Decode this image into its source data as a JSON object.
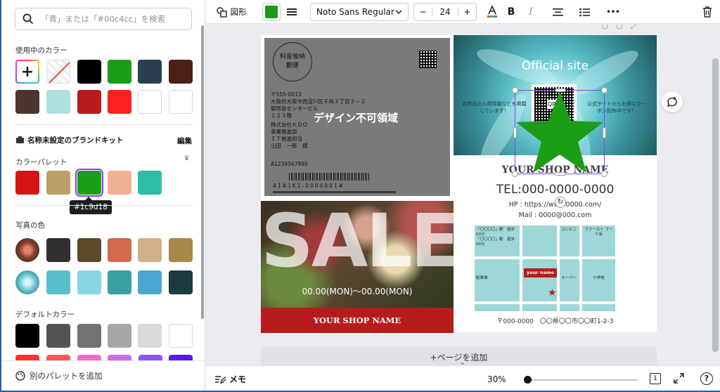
{
  "left_panel": {
    "search_placeholder": "「青」または「#00c4cc」を検索",
    "in_use_title": "使用中のカラー",
    "in_use_colors": [
      "#000000",
      "#1c9d18",
      "#2c3e50",
      "#4a2018",
      "#4a3530",
      "#aee0de",
      "#b81c1c",
      "#ff1f1f",
      "#ffffff",
      "#ffffff"
    ],
    "brand_kit": "名称未設定のブランドキット",
    "edit": "編集",
    "palette_title": "カラーパレット",
    "palette": [
      "#d71414",
      "#b9a064",
      "#1c9d18",
      "#f0b296",
      "#2ebca2"
    ],
    "tooltip": "#1c9d18",
    "photo_title": "写真の色",
    "photo_colors_1": [
      "#2f2f2f",
      "#5d4a2b",
      "#d36a4c",
      "#cfb08c",
      "#a88848"
    ],
    "photo_colors_2": [
      "#56bfcb",
      "#88d6e4",
      "#3aa19e",
      "#4aa6d0",
      "#1d3a3e"
    ],
    "default_title": "デフォルトカラー",
    "default_colors": [
      "#000000",
      "#545454",
      "#737373",
      "#a6a6a6",
      "#d9d9d9",
      "#ffffff"
    ],
    "add_palette": "別のパレットを追加"
  },
  "toolbar": {
    "shape": "図形",
    "font": "Noto Sans Regular",
    "font_size": "24",
    "minus": "−",
    "plus": "+",
    "bold": "B",
    "italic": "I",
    "more": "•••"
  },
  "postcard": {
    "stamp": "料金後納郵便",
    "stamp_l1": "料金後納",
    "stamp_l2": "郵便",
    "zip": "〒555-0013",
    "addr1": "大阪府大阪市西淀川区千舟３丁目３－２",
    "addr2": "御幣島センタービル",
    "addr3": "１２３階",
    "addr4": "株式会社ＫＤＯ",
    "addr5": "事業推進部",
    "addr6": "ＩＴ推進担当",
    "addr7": "山田　一郎　様",
    "code": "A1234567890",
    "barcode_text": "A1A1K1-0000001#",
    "overlay": "デザイン不可領域",
    "official": "Official site",
    "new_item": "新商品の入荷情報なども掲載しています！",
    "coupon": "公式サイトからお得なクーポン配布中です！",
    "qr_label": "QRタ",
    "sale": "SALE",
    "sale_date": "00.00(MON)〜00.00(MON)",
    "shop_name_bar": "YOUR SHOP NAME",
    "shop_name": "YOUR SHOP NAME",
    "tel": "TEL:000-0000-0000",
    "hp": "HP : https://ww   00000.com/",
    "mail": "Mail : 0000@000.com",
    "map_station": "「〇〇〇〇」駅　徒歩00分",
    "map_conv": "コンビニ",
    "map_ff": "ファースト フード店",
    "map_parking": "駐車場",
    "map_super": "スーパー",
    "map_school": "小学校",
    "map_pin": "your name",
    "address_line": "〒000-0000　〇〇県〇〇市〇〇町1-2-3",
    "add_page": "+ページを追加"
  },
  "footer": {
    "memo": "メモ",
    "zoom": "30%",
    "page_count": "1"
  },
  "colors": {
    "selected_fill": "#1c9d18",
    "accent": "#8b3dff"
  }
}
